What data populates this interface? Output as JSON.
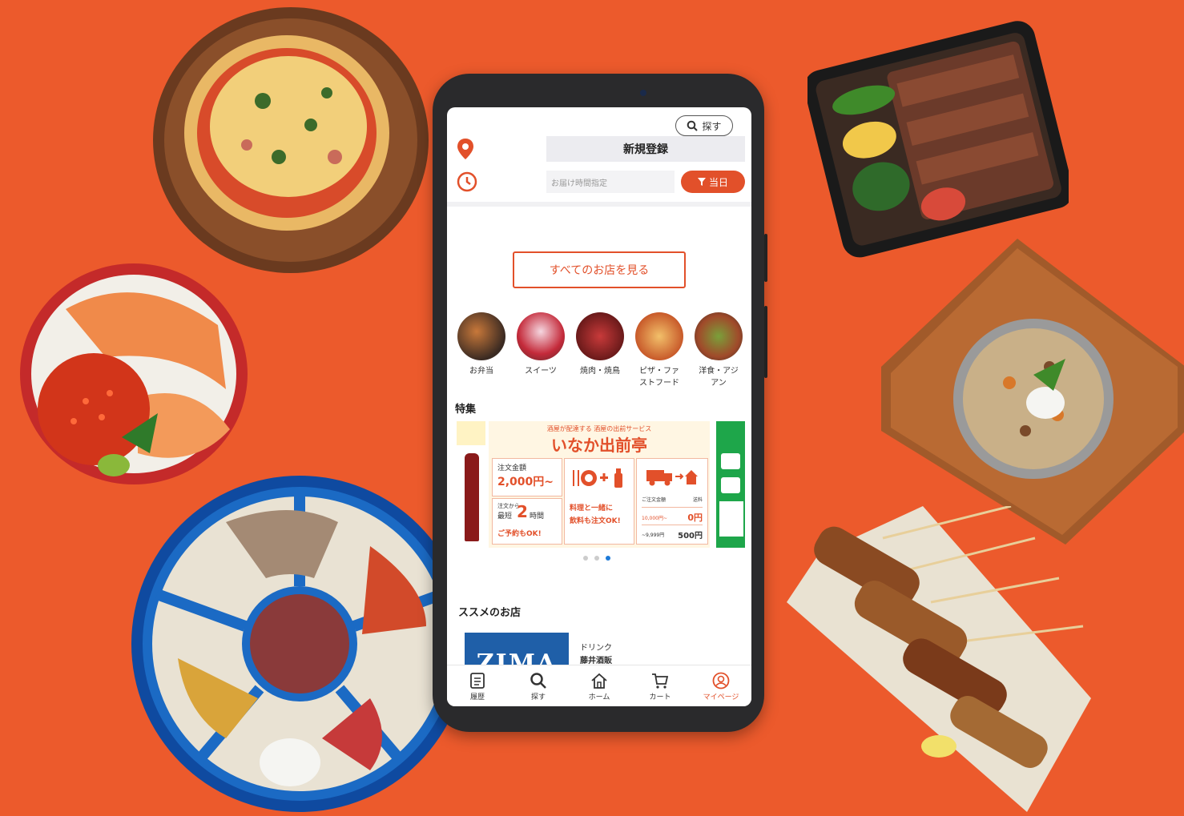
{
  "app": {
    "search_label": "探す",
    "register_label": "新規登録",
    "delivery_time_placeholder": "お届け時間指定",
    "today_label": "当日",
    "view_all_stores": "すべてのお店を見る",
    "categories": [
      {
        "line1": "お弁当",
        "line2": ""
      },
      {
        "line1": "スイーツ",
        "line2": ""
      },
      {
        "line1": "焼肉・焼鳥",
        "line2": ""
      },
      {
        "line1": "ピザ・ファ",
        "line2": "ストフード"
      },
      {
        "line1": "洋食・アジ",
        "line2": "アン"
      }
    ],
    "feature_heading": "特集",
    "banner": {
      "subtitle": "酒屋が配達する 酒屋の出前サービス",
      "title": "いなか出前亭",
      "order_min_label": "注文金額",
      "order_min_value": "2,000円~",
      "lead_time_prefix": "注文から",
      "lead_time_shortest": "最短",
      "lead_time_hours": "2",
      "lead_time_unit": "時間",
      "reserve_ok": "ご予約もOK!",
      "food_drink_1": "料理と一緒に",
      "food_drink_2": "飲料も注文OK!",
      "fee_header_amount": "ご注文金額",
      "fee_header_shipping": "送料",
      "fee_row1_amount": "10,000円~",
      "fee_row1_fee": "0円",
      "fee_row2_amount": "~9,999円",
      "fee_row2_fee": "500円"
    },
    "recommended_heading": "ススメのお店",
    "shop": {
      "image_text": "ZIMA",
      "category": "ドリンク",
      "name": "藤井酒販"
    },
    "tabs": [
      {
        "label": "履歴"
      },
      {
        "label": "探す"
      },
      {
        "label": "ホーム"
      },
      {
        "label": "カート"
      },
      {
        "label": "マイページ"
      }
    ],
    "carousel_active_index": 2,
    "colors": {
      "background": "#ec5a2c",
      "accent": "#e2502a",
      "active_dot": "#1d7ad8"
    }
  }
}
